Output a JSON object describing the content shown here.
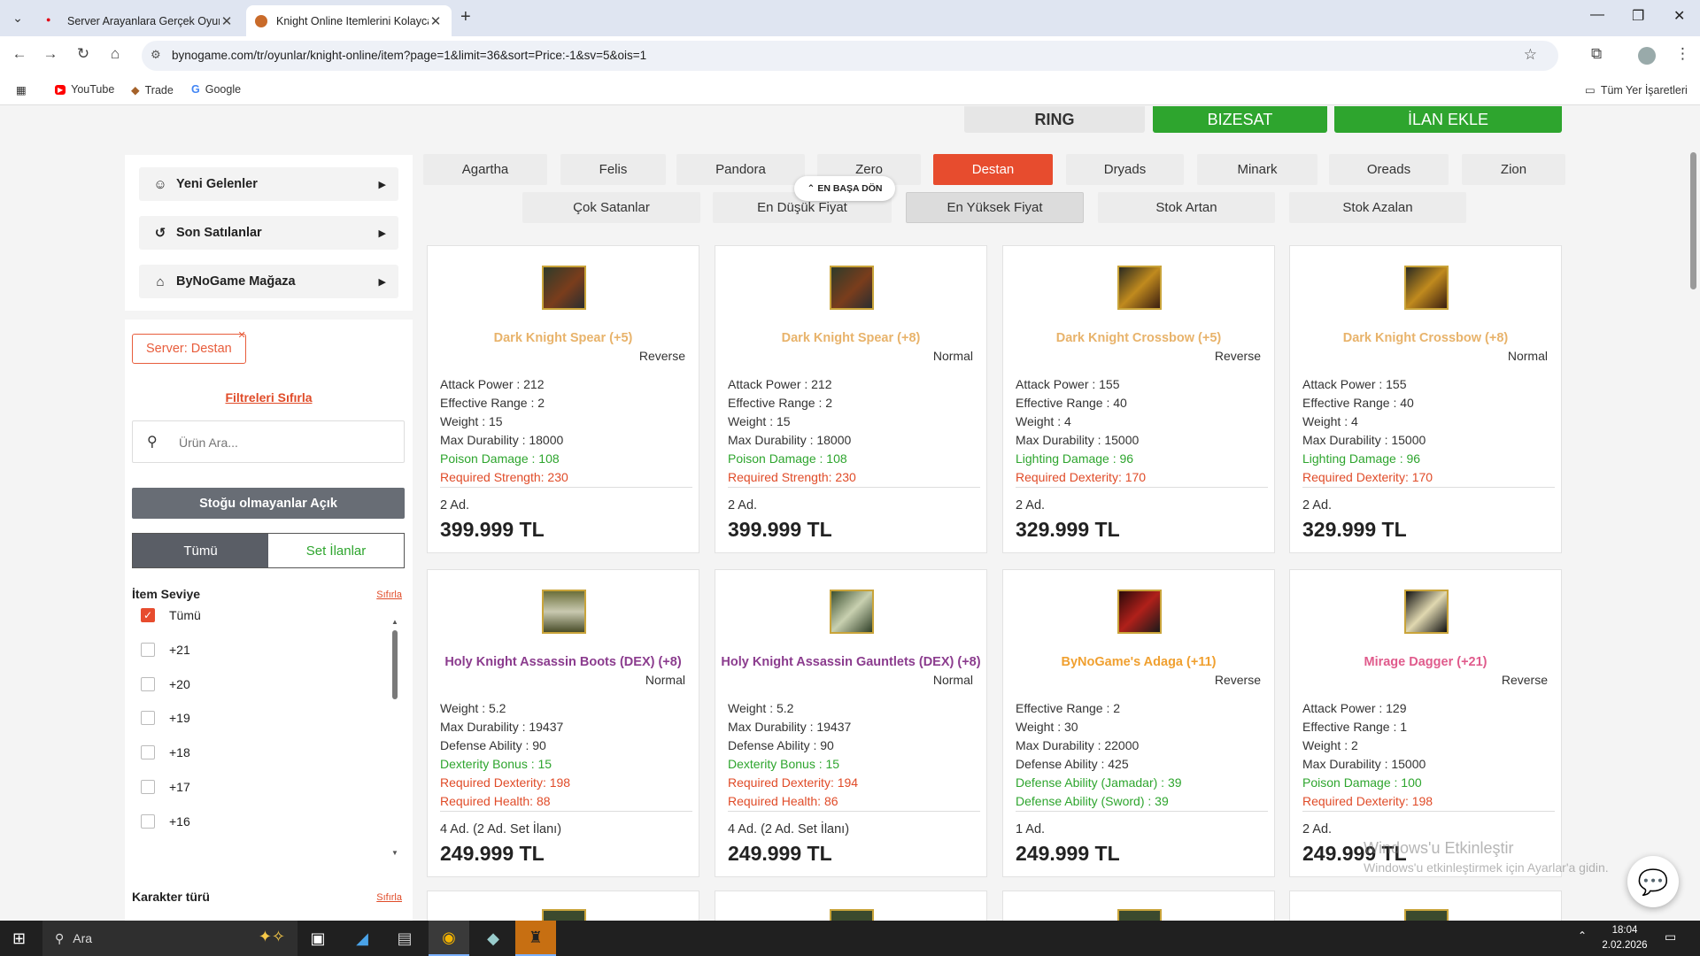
{
  "browser": {
    "tabs": [
      {
        "title": "Server Arayanlara Gerçek Oyun",
        "close": "✕"
      },
      {
        "title": "Knight Online Itemlerini Kolayca",
        "close": "✕"
      }
    ],
    "new_tab": "+",
    "url": "bynogame.com/tr/oyunlar/knight-online/item?page=1&limit=36&sort=Price:-1&sv=5&ois=1",
    "bookmarks": [
      "YouTube",
      "Trade",
      "Google"
    ],
    "all_bookmarks": "Tüm Yer İşaretleri"
  },
  "top_buttons": [
    "RING",
    "BIZESAT",
    "İLAN EKLE"
  ],
  "sidebar": {
    "menu": [
      "Yeni Gelenler",
      "Son Satılanlar",
      "ByNoGame Mağaza"
    ],
    "server_chip": "Server: Destan",
    "reset_filters": "Filtreleri Sıfırla",
    "search_placeholder": "Ürün Ara...",
    "stock_button": "Stoğu olmayanlar Açık",
    "toggle": [
      "Tümü",
      "Set İlanlar"
    ],
    "item_level": {
      "title": "İtem Seviye",
      "reset": "Sıfırla",
      "options": [
        "Tümü",
        "+21",
        "+20",
        "+19",
        "+18",
        "+17",
        "+16"
      ]
    },
    "char_type": {
      "title": "Karakter türü",
      "reset": "Sıfırla"
    }
  },
  "servers": [
    "Agartha",
    "Felis",
    "Pandora",
    "Zero",
    "Destan",
    "Dryads",
    "Minark",
    "Oreads",
    "Zion"
  ],
  "active_server": "Destan",
  "sorts": [
    "Çok Satanlar",
    "En Düşük Fiyat",
    "En Yüksek Fiyat",
    "Stok Artan",
    "Stok Azalan"
  ],
  "active_sort": "En Yüksek Fiyat",
  "back_to_top": "EN BAŞA DÖN",
  "cards": [
    {
      "name": "Dark Knight Spear (+5)",
      "grade": "Reverse",
      "name_color": "gold",
      "stats": [
        [
          "Attack Power : 212",
          "n"
        ],
        [
          "Effective Range : 2",
          "n"
        ],
        [
          "Weight : 15",
          "n"
        ],
        [
          "Max Durability : 18000",
          "n"
        ],
        [
          "Poison Damage : 108",
          "g"
        ],
        [
          "Required Strength: 230",
          "r"
        ]
      ],
      "qty": "2 Ad.",
      "price": "399.999 TL"
    },
    {
      "name": "Dark Knight Spear (+8)",
      "grade": "Normal",
      "name_color": "gold",
      "stats": [
        [
          "Attack Power : 212",
          "n"
        ],
        [
          "Effective Range : 2",
          "n"
        ],
        [
          "Weight : 15",
          "n"
        ],
        [
          "Max Durability : 18000",
          "n"
        ],
        [
          "Poison Damage : 108",
          "g"
        ],
        [
          "Required Strength: 230",
          "r"
        ]
      ],
      "qty": "2 Ad.",
      "price": "399.999 TL"
    },
    {
      "name": "Dark Knight Crossbow (+5)",
      "grade": "Reverse",
      "name_color": "gold",
      "stats": [
        [
          "Attack Power : 155",
          "n"
        ],
        [
          "Effective Range : 40",
          "n"
        ],
        [
          "Weight : 4",
          "n"
        ],
        [
          "Max Durability : 15000",
          "n"
        ],
        [
          "Lighting Damage : 96",
          "g"
        ],
        [
          "Required Dexterity: 170",
          "r"
        ]
      ],
      "qty": "2 Ad.",
      "price": "329.999 TL"
    },
    {
      "name": "Dark Knight Crossbow (+8)",
      "grade": "Normal",
      "name_color": "gold",
      "stats": [
        [
          "Attack Power : 155",
          "n"
        ],
        [
          "Effective Range : 40",
          "n"
        ],
        [
          "Weight : 4",
          "n"
        ],
        [
          "Max Durability : 15000",
          "n"
        ],
        [
          "Lighting Damage : 96",
          "g"
        ],
        [
          "Required Dexterity: 170",
          "r"
        ]
      ],
      "qty": "2 Ad.",
      "price": "329.999 TL"
    },
    {
      "name": "Holy Knight Assassin Boots (DEX) (+8)",
      "grade": "Normal",
      "name_color": "purple",
      "stats": [
        [
          "Weight : 5.2",
          "n"
        ],
        [
          "Max Durability : 19437",
          "n"
        ],
        [
          "Defense Ability : 90",
          "n"
        ],
        [
          "Dexterity Bonus : 15",
          "g"
        ],
        [
          "Required Dexterity: 198",
          "r"
        ],
        [
          "Required Health: 88",
          "r"
        ]
      ],
      "qty": "4 Ad. (2 Ad. Set İlanı)",
      "price": "249.999 TL"
    },
    {
      "name": "Holy Knight Assassin Gauntlets (DEX) (+8)",
      "grade": "Normal",
      "name_color": "purple",
      "stats": [
        [
          "Weight : 5.2",
          "n"
        ],
        [
          "Max Durability : 19437",
          "n"
        ],
        [
          "Defense Ability : 90",
          "n"
        ],
        [
          "Dexterity Bonus : 15",
          "g"
        ],
        [
          "Required Dexterity: 194",
          "r"
        ],
        [
          "Required Health: 86",
          "r"
        ]
      ],
      "qty": "4 Ad. (2 Ad. Set İlanı)",
      "price": "249.999 TL"
    },
    {
      "name": "ByNoGame's Adaga (+11)",
      "grade": "Reverse",
      "name_color": "orange",
      "stats": [
        [
          "Effective Range : 2",
          "n"
        ],
        [
          "Weight : 30",
          "n"
        ],
        [
          "Max Durability : 22000",
          "n"
        ],
        [
          "Defense Ability : 425",
          "n"
        ],
        [
          "Defense Ability (Jamadar) : 39",
          "g"
        ],
        [
          "Defense Ability (Sword) : 39",
          "g"
        ]
      ],
      "qty": "1 Ad.",
      "price": "249.999 TL"
    },
    {
      "name": "Mirage Dagger (+21)",
      "grade": "Reverse",
      "name_color": "pink",
      "stats": [
        [
          "Attack Power : 129",
          "n"
        ],
        [
          "Effective Range : 1",
          "n"
        ],
        [
          "Weight : 2",
          "n"
        ],
        [
          "Max Durability : 15000",
          "n"
        ],
        [
          "Poison Damage : 100",
          "g"
        ],
        [
          "Required Dexterity: 198",
          "r"
        ]
      ],
      "qty": "2 Ad.",
      "price": "249.999 TL"
    }
  ],
  "watermark": {
    "line1": "Windows'u Etkinleştir",
    "line2": "Windows'u etkinleştirmek için Ayarlar'a gidin."
  },
  "taskbar": {
    "search": "Ara",
    "time": "18:04",
    "date": "2.02.2026"
  }
}
